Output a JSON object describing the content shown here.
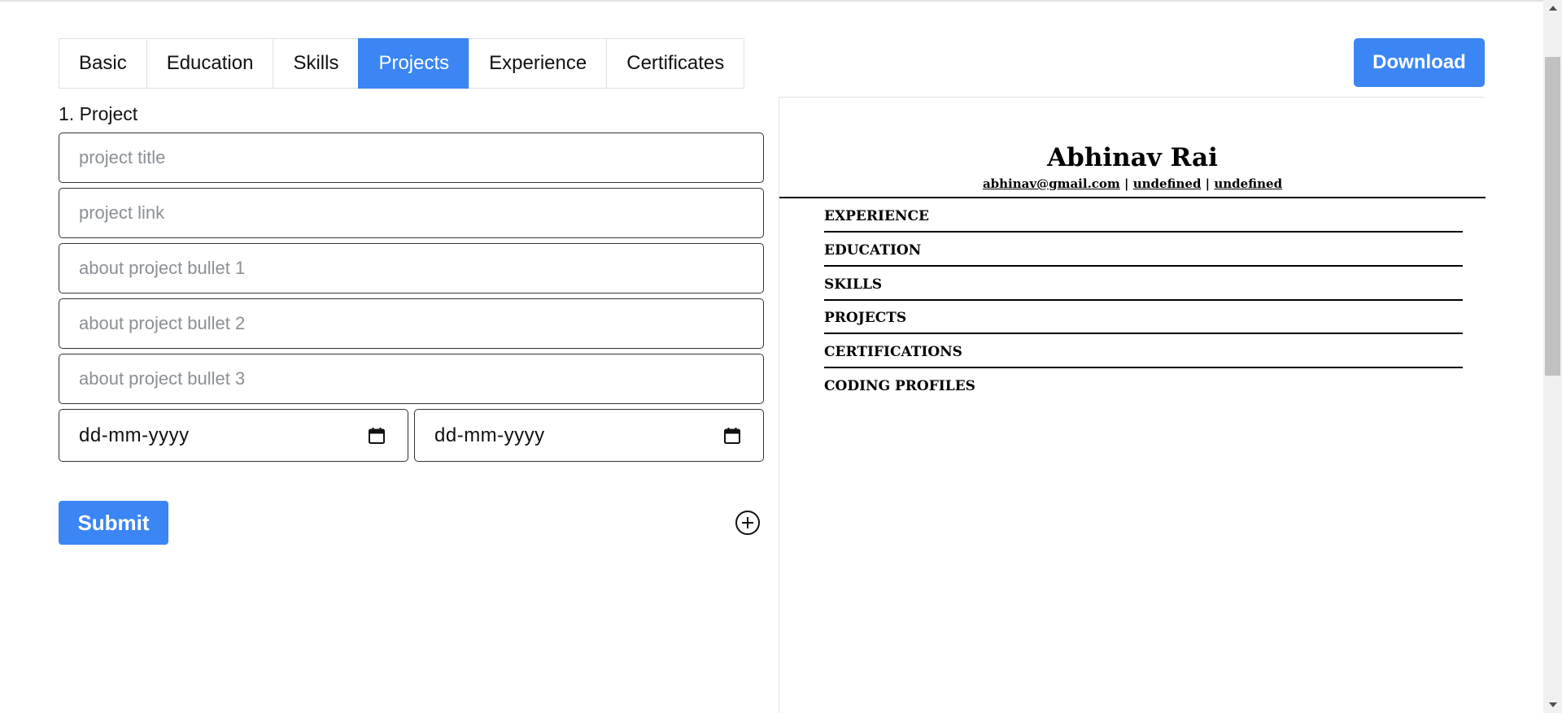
{
  "tabs": [
    {
      "label": "Basic",
      "active": false
    },
    {
      "label": "Education",
      "active": false
    },
    {
      "label": "Skills",
      "active": false
    },
    {
      "label": "Projects",
      "active": true
    },
    {
      "label": "Experience",
      "active": false
    },
    {
      "label": "Certificates",
      "active": false
    }
  ],
  "toolbar": {
    "download_label": "Download"
  },
  "form": {
    "section_label": "1. Project",
    "fields": {
      "title_placeholder": "project title",
      "link_placeholder": "project link",
      "bullet1_placeholder": "about project bullet 1",
      "bullet2_placeholder": "about project bullet 2",
      "bullet3_placeholder": "about project bullet 3"
    },
    "start_date": "dd-mm-yyyy",
    "end_date": "dd-mm-yyyy",
    "submit_label": "Submit",
    "add_icon": "plus-circle-icon"
  },
  "resume": {
    "name": "Abhinav Rai",
    "email": "abhinav@gmail.com",
    "separator": "|",
    "link1": "undefined",
    "link2": "undefined",
    "sections": {
      "experience": "EXPERIENCE",
      "education": "EDUCATION",
      "skills": "SKILLS",
      "projects": "PROJECTS",
      "certifications": "CERTIFICATIONS",
      "coding_profiles": "CODING PROFILES"
    }
  },
  "colors": {
    "accent": "#3b86f4",
    "border": "#333333",
    "placeholder": "#8a9096"
  }
}
